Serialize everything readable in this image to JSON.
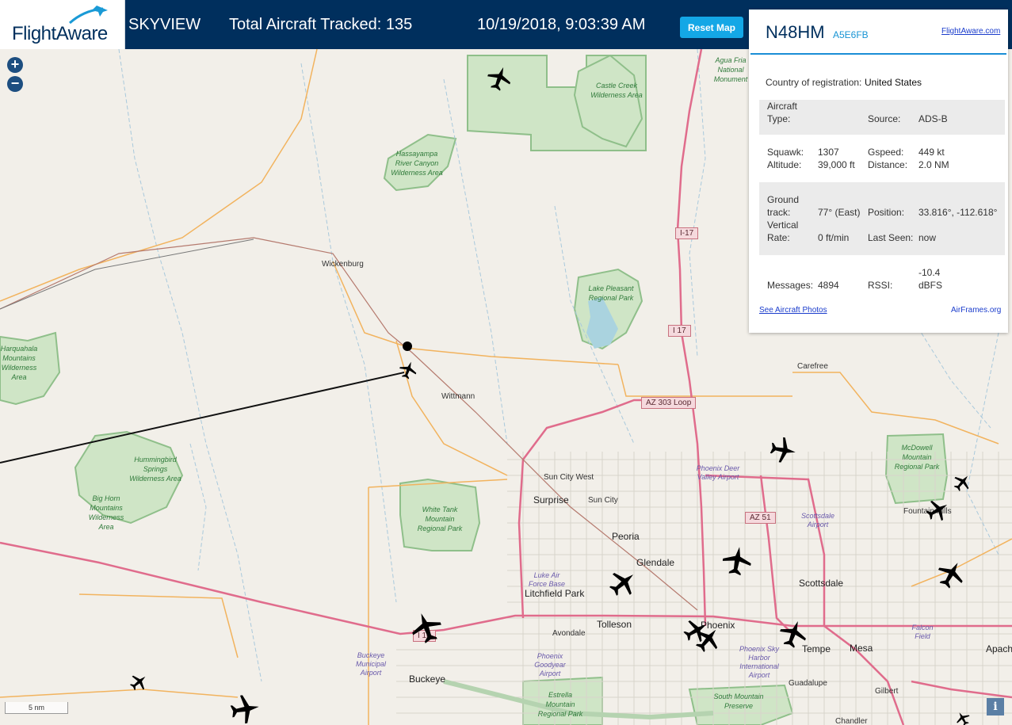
{
  "header": {
    "logo": "FlightAware",
    "skyview": "SKYVIEW",
    "total_tracked": "Total Aircraft Tracked: 135",
    "datetime": "10/19/2018, 9:03:39 AM",
    "reset_button": "Reset Map"
  },
  "map_controls": {
    "zoom_in": "+",
    "zoom_out": "−",
    "scale": "5 nm",
    "info": "i"
  },
  "map_labels": {
    "cities": [
      "Surprise",
      "Peoria",
      "Glendale",
      "Litchfield Park",
      "Tolleson",
      "Phoenix",
      "Scottsdale",
      "Tempe",
      "Mesa",
      "Apache",
      "Buckeye"
    ],
    "towns": [
      "Wickenburg",
      "Wittmann",
      "Sun City West",
      "Sun City",
      "Avondale",
      "Carefree",
      "Guadalupe",
      "Gilbert",
      "Chandler",
      "Fountain Hills"
    ],
    "parks": {
      "castle_creek": "Castle Creek Wilderness Area",
      "hassayampa": "Hassayampa River Canyon Wilderness Area",
      "lake_pleasant": "Lake Pleasant Regional Park",
      "harquahala": "Harquahala Mountains Wilderness Area",
      "hummingbird": "Hummingbird Springs Wilderness Area",
      "big_horn": "Big Horn Mountains Wilderness Area",
      "white_tank": "White Tank Mountain Regional Park",
      "mcdowell": "McDowell Mountain Regional Park",
      "estrella": "Estrella Mountain Regional Park",
      "south_mountain": "South Mountain Preserve",
      "agua_fria": "Agua Fria National Monument"
    },
    "airports": {
      "deer_valley": "Phoenix Deer Valley Airport",
      "scottsdale": "Scottsdale Airport",
      "luke": "Luke Air Force Base",
      "goodyear": "Phoenix Goodyear Airport",
      "buckeye": "Buckeye Municipal Airport",
      "sky_harbor": "Phoenix Sky Harbor International Airport",
      "falcon": "Falcon Field"
    },
    "shields": [
      "I-17",
      "I 17",
      "AZ 303 Loop",
      "AZ 51",
      "I 10"
    ]
  },
  "aircraft_heading": {
    "selected": 77,
    "others": [
      20,
      100,
      40,
      60,
      10,
      30,
      50,
      -20,
      60,
      40,
      20,
      50,
      80,
      -30
    ]
  },
  "detail_panel": {
    "ident": "N48HM",
    "hex": "A5E6FB",
    "fa_link": "FlightAware.com",
    "country_label": "Country of registration:",
    "country_value": "United States",
    "aircraft_type_label": "Aircraft Type:",
    "aircraft_type_value": "",
    "source_label": "Source:",
    "source_value": "ADS-B",
    "squawk_label": "Squawk:",
    "squawk_value": "1307",
    "gspeed_label": "Gspeed:",
    "gspeed_value": "449 kt",
    "altitude_label": "Altitude:",
    "altitude_value": "39,000 ft",
    "distance_label": "Distance:",
    "distance_value": "2.0 NM",
    "ground_track_label": "Ground track:",
    "ground_track_value": "77° (East)",
    "position_label": "Position:",
    "position_value": "33.816°, -112.618°",
    "vertical_rate_label": "Vertical Rate:",
    "vertical_rate_value": "0 ft/min",
    "last_seen_label": "Last Seen:",
    "last_seen_value": "now",
    "messages_label": "Messages:",
    "messages_value": "4894",
    "rssi_label": "RSSI:",
    "rssi_value": "-10.4 dBFS",
    "photos_link": "See Aircraft Photos",
    "airframes_link": "AirFrames.org"
  },
  "colors": {
    "header_bg": "#002f5d",
    "accent": "#14a7e6",
    "park_green": "#8fbf8a",
    "highway": "#e06c8c",
    "arterial": "#f2b35e"
  }
}
